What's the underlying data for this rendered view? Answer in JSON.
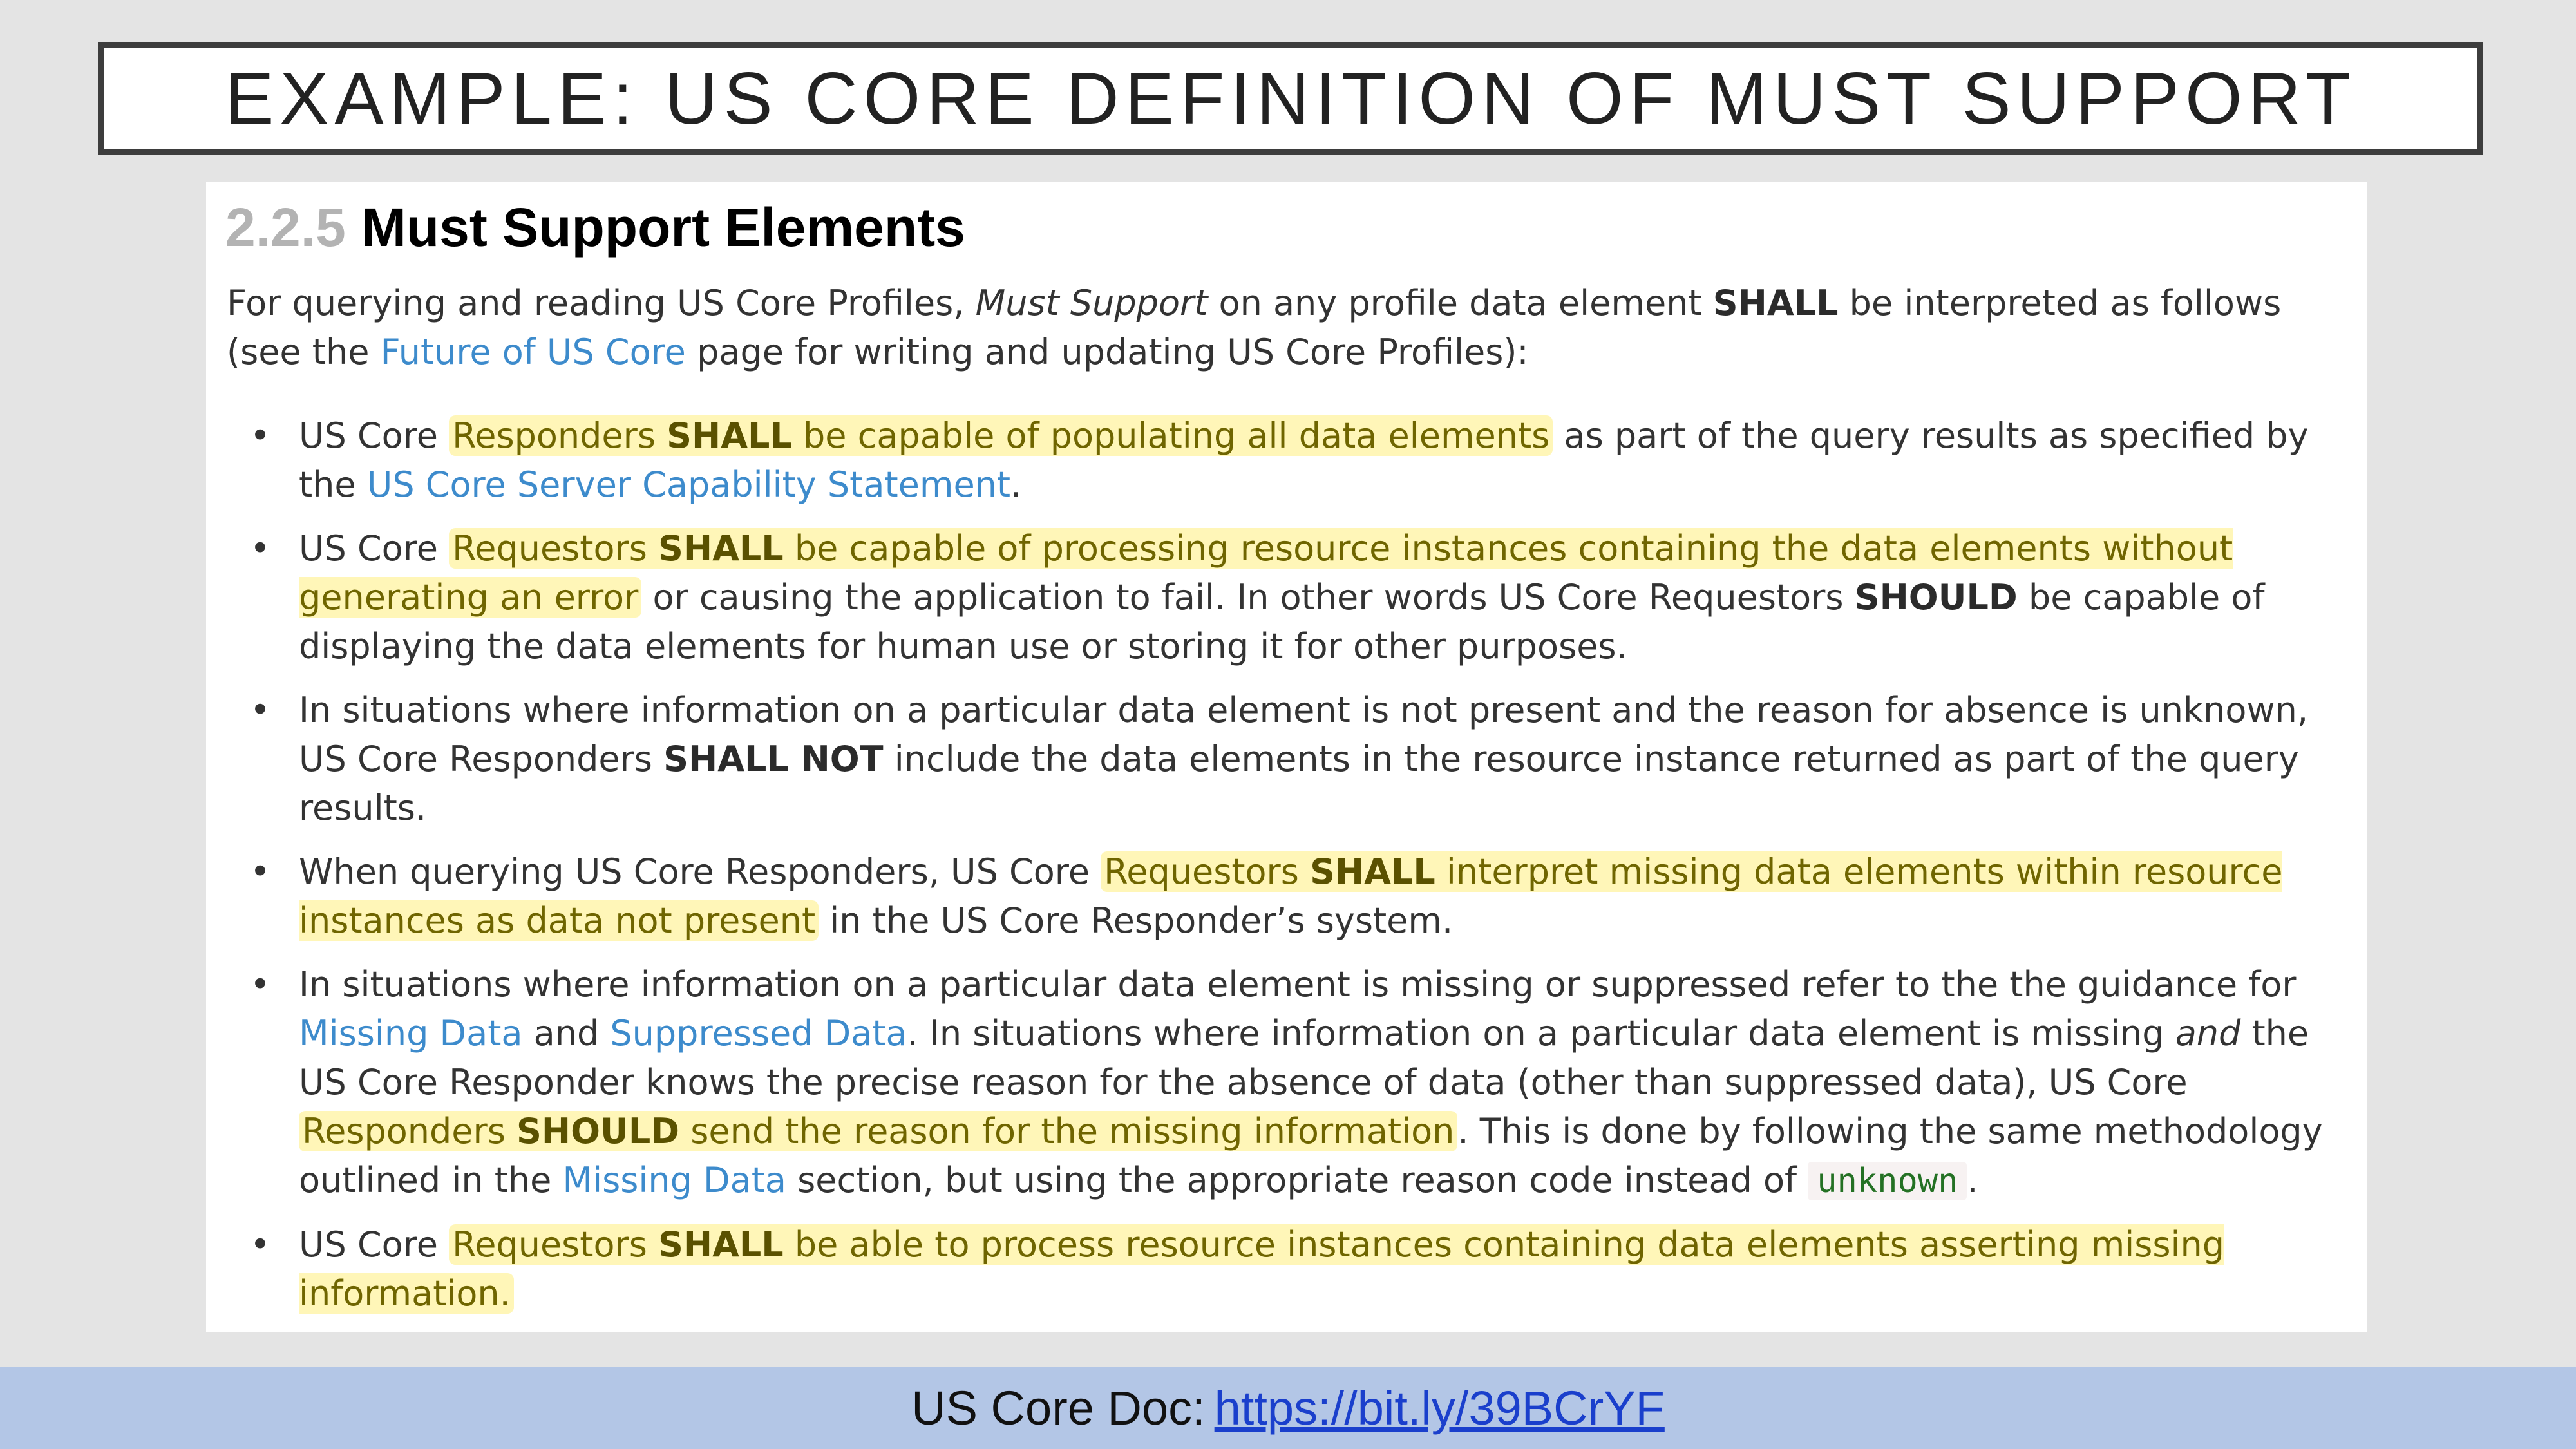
{
  "slide": {
    "title": "EXAMPLE: US CORE DEFINITION OF MUST SUPPORT"
  },
  "doc": {
    "section_number": "2.2.5",
    "section_title": "Must Support Elements",
    "intro": {
      "t1": "For querying and reading US Core Profiles, ",
      "em1": "Must Support",
      "t2": " on any profile data element ",
      "b1": "SHALL",
      "t3": " be interpreted as follows (see the ",
      "link1": "Future of US Core",
      "t4": " page for writing and updating US Core Profiles):"
    },
    "bullets": {
      "b1": {
        "t1": "US Core ",
        "h1": "Responders ",
        "hb": "SHALL",
        "h2": " be capable of populating all data elements",
        "t2": " as part of the query results as specified by the ",
        "link": "US Core Server Capability Statement",
        "t3": "."
      },
      "b2": {
        "t1": "US Core ",
        "h1": "Requestors ",
        "hb": "SHALL",
        "h2": " be capable of processing resource instances containing the data elements without generating an error",
        "t2": " or causing the application to fail. In other words US Core Requestors ",
        "b": "SHOULD",
        "t3": " be capable of displaying the data elements for human use or storing it for other purposes."
      },
      "b3": {
        "t1": "In situations where information on a particular data element is not present and the reason for absence is unknown, US Core Responders ",
        "b": "SHALL NOT",
        "t2": " include the data elements in the resource instance returned as part of the query results."
      },
      "b4": {
        "t1": "When querying US Core Responders, US Core ",
        "h1": "Requestors ",
        "hb": "SHALL",
        "h2": " interpret missing data elements within resource instances as data not present",
        "t2": " in the US Core Responder’s system."
      },
      "b5": {
        "t1": "In situations where information on a particular data element is missing or suppressed refer to the the guidance for ",
        "link1": "Missing Data",
        "t2": " and ",
        "link2": "Suppressed Data",
        "t3": ". In situations where information on a particular data element is missing ",
        "em": "and",
        "t4": " the US Core Responder knows the precise reason for the absence of data (other than suppressed data), US Core ",
        "h1": "Responders ",
        "hb": "SHOULD",
        "h2": " send the reason for the missing information",
        "t5": ". This is done by following the same methodology outlined in the ",
        "link3": "Missing Data",
        "t6": " section, but using the appropriate reason code instead of ",
        "code": "unknown",
        "t7": "."
      },
      "b6": {
        "t1": "US Core ",
        "h1": "Requestors ",
        "hb": "SHALL",
        "h2": " be able to process resource instances containing data elements asserting missing information."
      }
    }
  },
  "footer": {
    "label": "US Core Doc:",
    "link": "https://bit.ly/39BCrYF"
  },
  "colors": {
    "highlight_bg": "#fff6b8",
    "highlight_text": "#6f6500",
    "link": "#3d8bcc",
    "footer_bg": "#b3c6e6",
    "footer_link": "#1a3fcc"
  }
}
